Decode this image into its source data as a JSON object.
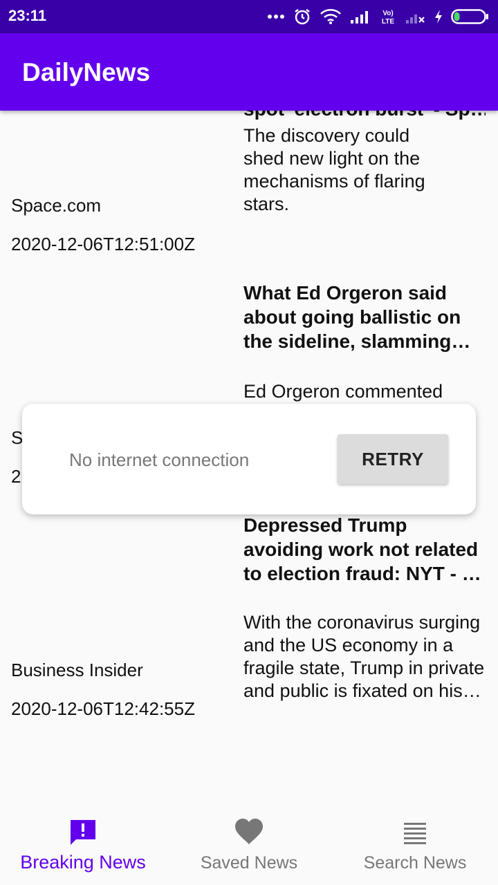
{
  "status_bar": {
    "time": "23:11",
    "icons": [
      "more-dots-icon",
      "alarm-icon",
      "wifi-icon",
      "signal-icon",
      "volte-icon",
      "signal-no-sim-icon",
      "charging-icon",
      "battery-icon"
    ],
    "volte_label": "Vo LTE"
  },
  "app_bar": {
    "title": "DailyNews"
  },
  "articles": [
    {
      "source": "",
      "published_at": "",
      "title": "spot 'electron burst' - Sp…",
      "description": "The discovery could shed new light on the mechanisms of flaring stars."
    },
    {
      "source": "Space.com",
      "published_at": "2020-12-06T12:51:00Z",
      "title": "What Ed Orgeron said about going ballistic on the sideline, slamming h…",
      "description": "Ed Orgeron commented"
    },
    {
      "source": "S",
      "published_at": "2",
      "title": "Depressed Trump avoiding work not related to election fraud: NYT - …",
      "description": "With the coronavirus surging and the US economy in a fragile state, Trump in private and public is fixated on his groundles…"
    },
    {
      "source": "Business Insider",
      "published_at": "2020-12-06T12:42:55Z"
    }
  ],
  "snackbar": {
    "message": "No internet connection",
    "action_label": "RETRY"
  },
  "bottom_nav": {
    "items": [
      {
        "label": "Breaking News",
        "icon": "breaking-news-icon",
        "active": true
      },
      {
        "label": "Saved News",
        "icon": "heart-icon",
        "active": false
      },
      {
        "label": "Search News",
        "icon": "list-icon",
        "active": false
      }
    ]
  },
  "colors": {
    "primary": "#6200ee",
    "status_bar": "#3a00a8",
    "battery_accent": "#4cd964"
  }
}
